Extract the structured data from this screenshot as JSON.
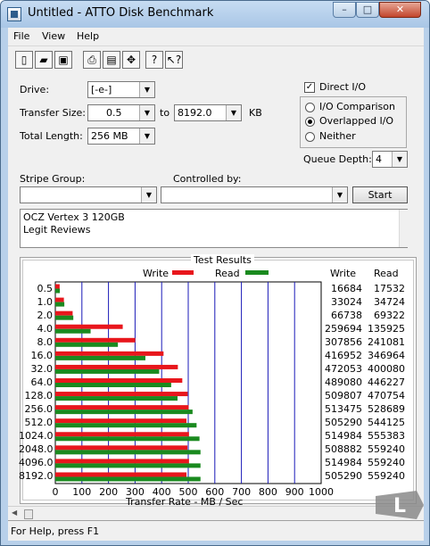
{
  "window": {
    "title": "Untitled - ATTO Disk Benchmark",
    "min_label": "–",
    "max_label": "□",
    "close_label": "✕"
  },
  "menu": [
    "File",
    "View",
    "Help"
  ],
  "toolbar_icons": [
    "new-icon",
    "open-icon",
    "save-icon",
    "print-icon",
    "print-preview-icon",
    "move-icon",
    "help-icon",
    "context-help-icon"
  ],
  "settings": {
    "drive_label": "Drive:",
    "drive_value": "[-e-]",
    "transfer_size_label": "Transfer Size:",
    "transfer_min": "0.5",
    "to_label": "to",
    "transfer_max": "8192.0",
    "kb_label": "KB",
    "total_length_label": "Total Length:",
    "total_length_value": "256 MB",
    "direct_io_label": "Direct I/O",
    "direct_io_checked": true,
    "io_comparison_label": "I/O Comparison",
    "overlapped_io_label": "Overlapped I/O",
    "neither_label": "Neither",
    "selected_mode": "Overlapped I/O",
    "queue_depth_label": "Queue Depth:",
    "queue_depth_value": "4",
    "stripe_group_label": "Stripe Group:",
    "controlled_by_label": "Controlled by:",
    "start_label": "Start"
  },
  "notes": [
    "OCZ Vertex 3 120GB",
    "Legit Reviews"
  ],
  "results": {
    "title": "Test Results",
    "write_legend": "Write",
    "read_legend": "Read",
    "write_col": "Write",
    "read_col": "Read"
  },
  "colors": {
    "write": "#e8161c",
    "read": "#1a8a1f",
    "grid": "#1a1ab8"
  },
  "chart_data": {
    "type": "bar",
    "orientation": "horizontal",
    "categories": [
      "0.5",
      "1.0",
      "2.0",
      "4.0",
      "8.0",
      "16.0",
      "32.0",
      "64.0",
      "128.0",
      "256.0",
      "512.0",
      "1024.0",
      "2048.0",
      "4096.0",
      "8192.0"
    ],
    "series": [
      {
        "name": "Write",
        "values": [
          16684,
          33024,
          66738,
          259694,
          307856,
          416952,
          472053,
          489080,
          509807,
          513475,
          505290,
          514984,
          508882,
          514984,
          505290
        ]
      },
      {
        "name": "Read",
        "values": [
          17532,
          34724,
          69322,
          135925,
          241081,
          346964,
          400080,
          446227,
          470754,
          528689,
          544125,
          555383,
          559240,
          559240,
          559240
        ]
      }
    ],
    "write_text": [
      "16684",
      "33024",
      "66738",
      "259694",
      "307856",
      "416952",
      "472053",
      "489080",
      "509807",
      "513475",
      "505290",
      "514984",
      "508882",
      "514984",
      "505290"
    ],
    "read_text": [
      "17532",
      "34724",
      "69322",
      "135925",
      "241081",
      "346964",
      "400080",
      "446227",
      "470754",
      "528689",
      "544125",
      "555383",
      "559240",
      "559240",
      "559240"
    ],
    "xticks": [
      "0",
      "100",
      "200",
      "300",
      "400",
      "500",
      "600",
      "700",
      "800",
      "900",
      "1000"
    ],
    "xlabel": "Transfer Rate - MB / Sec",
    "xlim": [
      0,
      1000
    ]
  },
  "status": {
    "text": "For Help, press F1"
  }
}
